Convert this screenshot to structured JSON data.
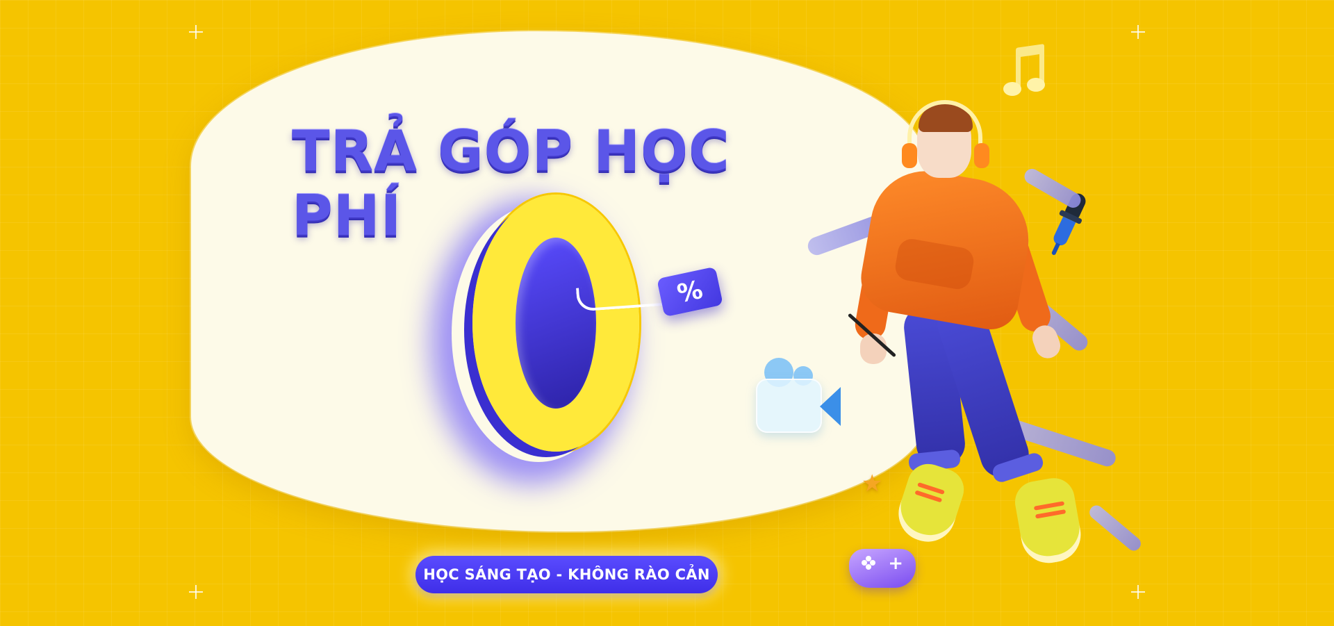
{
  "banner": {
    "headline": "TRẢ GÓP HỌC PHÍ",
    "big_number": "0",
    "percent_tag": "%",
    "cta_label": "HỌC SÁNG TẠO - KHÔNG RÀO CẢN"
  },
  "colors": {
    "background": "#f5c400",
    "panel": "#fdfae8",
    "accent_purple": "#5b56e8",
    "accent_yellow": "#ffe93a",
    "hoodie_orange": "#ff8c2a"
  },
  "icons": [
    "music-note-icon",
    "camera-icon",
    "gamepad-icon",
    "star-icon",
    "dropper-icon",
    "sparkle-icon"
  ]
}
